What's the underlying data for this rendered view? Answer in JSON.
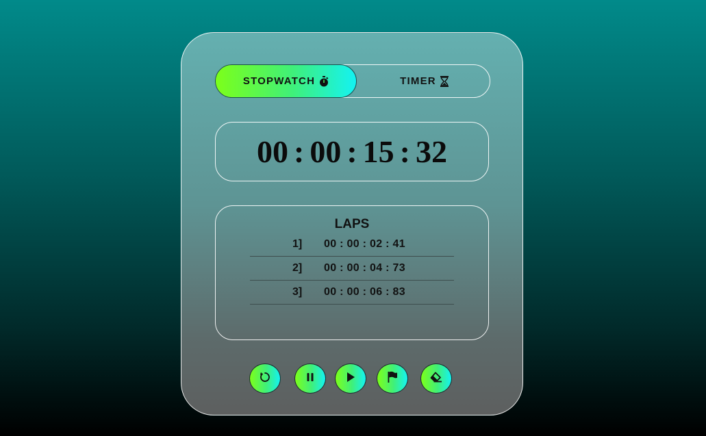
{
  "mode_toggle": {
    "stopwatch_label": "STOPWATCH",
    "timer_label": "TIMER",
    "active": "stopwatch"
  },
  "display": {
    "hours": "00",
    "minutes": "00",
    "seconds": "15",
    "centiseconds": "32",
    "separator": ":"
  },
  "laps": {
    "title": "LAPS",
    "items": [
      {
        "index": "1]",
        "time": "00 : 00 : 02 : 41"
      },
      {
        "index": "2]",
        "time": "00 : 00 : 04 : 73"
      },
      {
        "index": "3]",
        "time": "00 : 00 : 06 : 83"
      }
    ]
  },
  "controls": [
    {
      "name": "reset",
      "icon": "reset-icon"
    },
    {
      "name": "pause",
      "icon": "pause-icon"
    },
    {
      "name": "play",
      "icon": "play-icon"
    },
    {
      "name": "lap",
      "icon": "flag-icon"
    },
    {
      "name": "clear",
      "icon": "eraser-icon"
    }
  ],
  "colors": {
    "accent_gradient_start": "#7cff1a",
    "accent_gradient_end": "#14f2f2",
    "card_border": "#ffffff"
  }
}
